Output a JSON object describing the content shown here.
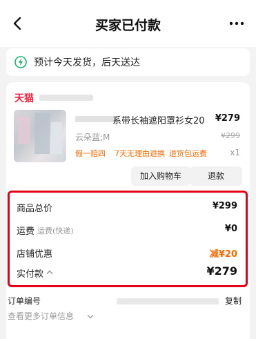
{
  "header": {
    "title": "买家已付款"
  },
  "shipping": {
    "text": "预计今天发货，后天送达"
  },
  "store": {
    "platform": "天猫"
  },
  "product": {
    "name_suffix": "系带长袖遮阳罩衫女20",
    "price": "¥279",
    "sku": "云朵蓝;M",
    "original_price": "¥299",
    "tags": [
      "假一赔四",
      "7天无理由退换",
      "退货包运费"
    ],
    "quantity": "x1"
  },
  "actions": {
    "add_to_cart": "加入购物车",
    "refund": "退款"
  },
  "summary": {
    "goods_total_label": "商品总价",
    "goods_total_value": "¥299",
    "shipping_label": "运费",
    "shipping_note": "运费(快递)",
    "shipping_value": "¥0",
    "discount_label": "店铺优惠",
    "discount_value": "减¥20",
    "paid_label": "实付款",
    "paid_value": "¥279"
  },
  "order": {
    "number_label": "订单编号",
    "copy_label": "复制",
    "more_info": "查看更多订单信息"
  },
  "colors": {
    "accent_red": "#e50017",
    "tmall_red": "#ff1f3a",
    "orange": "#ff6a00"
  }
}
